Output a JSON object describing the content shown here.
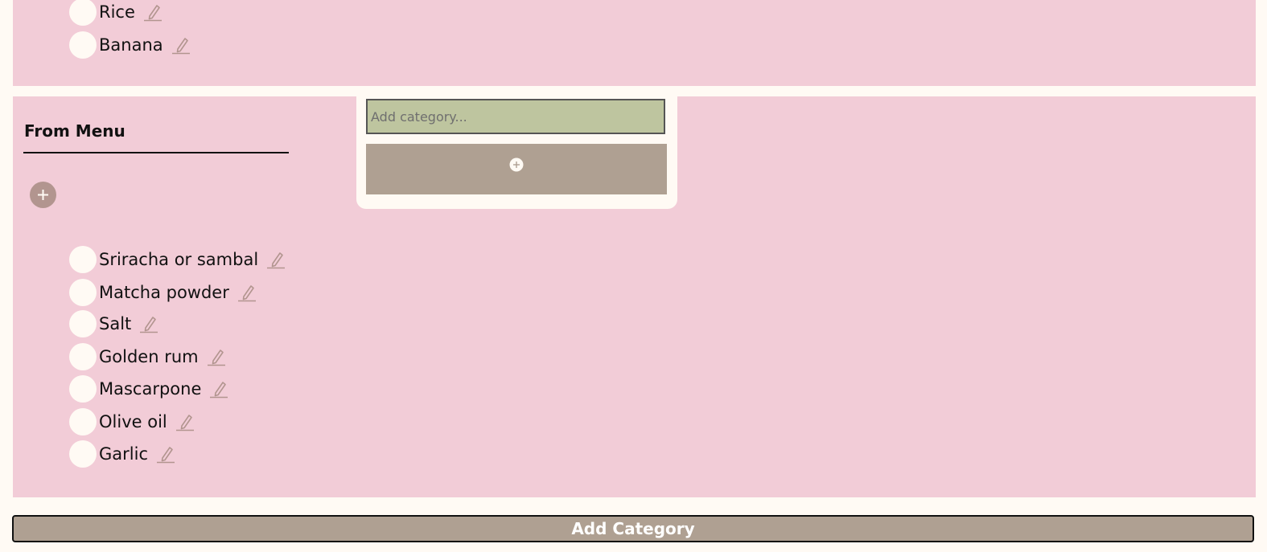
{
  "top_list": {
    "items": [
      {
        "label": "Rice"
      },
      {
        "label": "Banana"
      }
    ]
  },
  "from_menu": {
    "title": "From Menu",
    "items": [
      {
        "label": "Sriracha or sambal"
      },
      {
        "label": "Matcha powder"
      },
      {
        "label": "Salt"
      },
      {
        "label": "Golden rum"
      },
      {
        "label": "Mascarpone"
      },
      {
        "label": "Olive oil"
      },
      {
        "label": "Garlic"
      }
    ]
  },
  "category_popover": {
    "input_placeholder": "Add category...",
    "input_value": ""
  },
  "footer": {
    "add_category_label": "Add Category"
  },
  "icons": {
    "edit": "pencil-icon",
    "add": "plus-icon"
  },
  "colors": {
    "page_bg": "#fffaf4",
    "panel_bg": "#f2ccd7",
    "accent_taupe": "#afa092",
    "input_bg": "#bec59f",
    "round_button": "#b2958f"
  }
}
